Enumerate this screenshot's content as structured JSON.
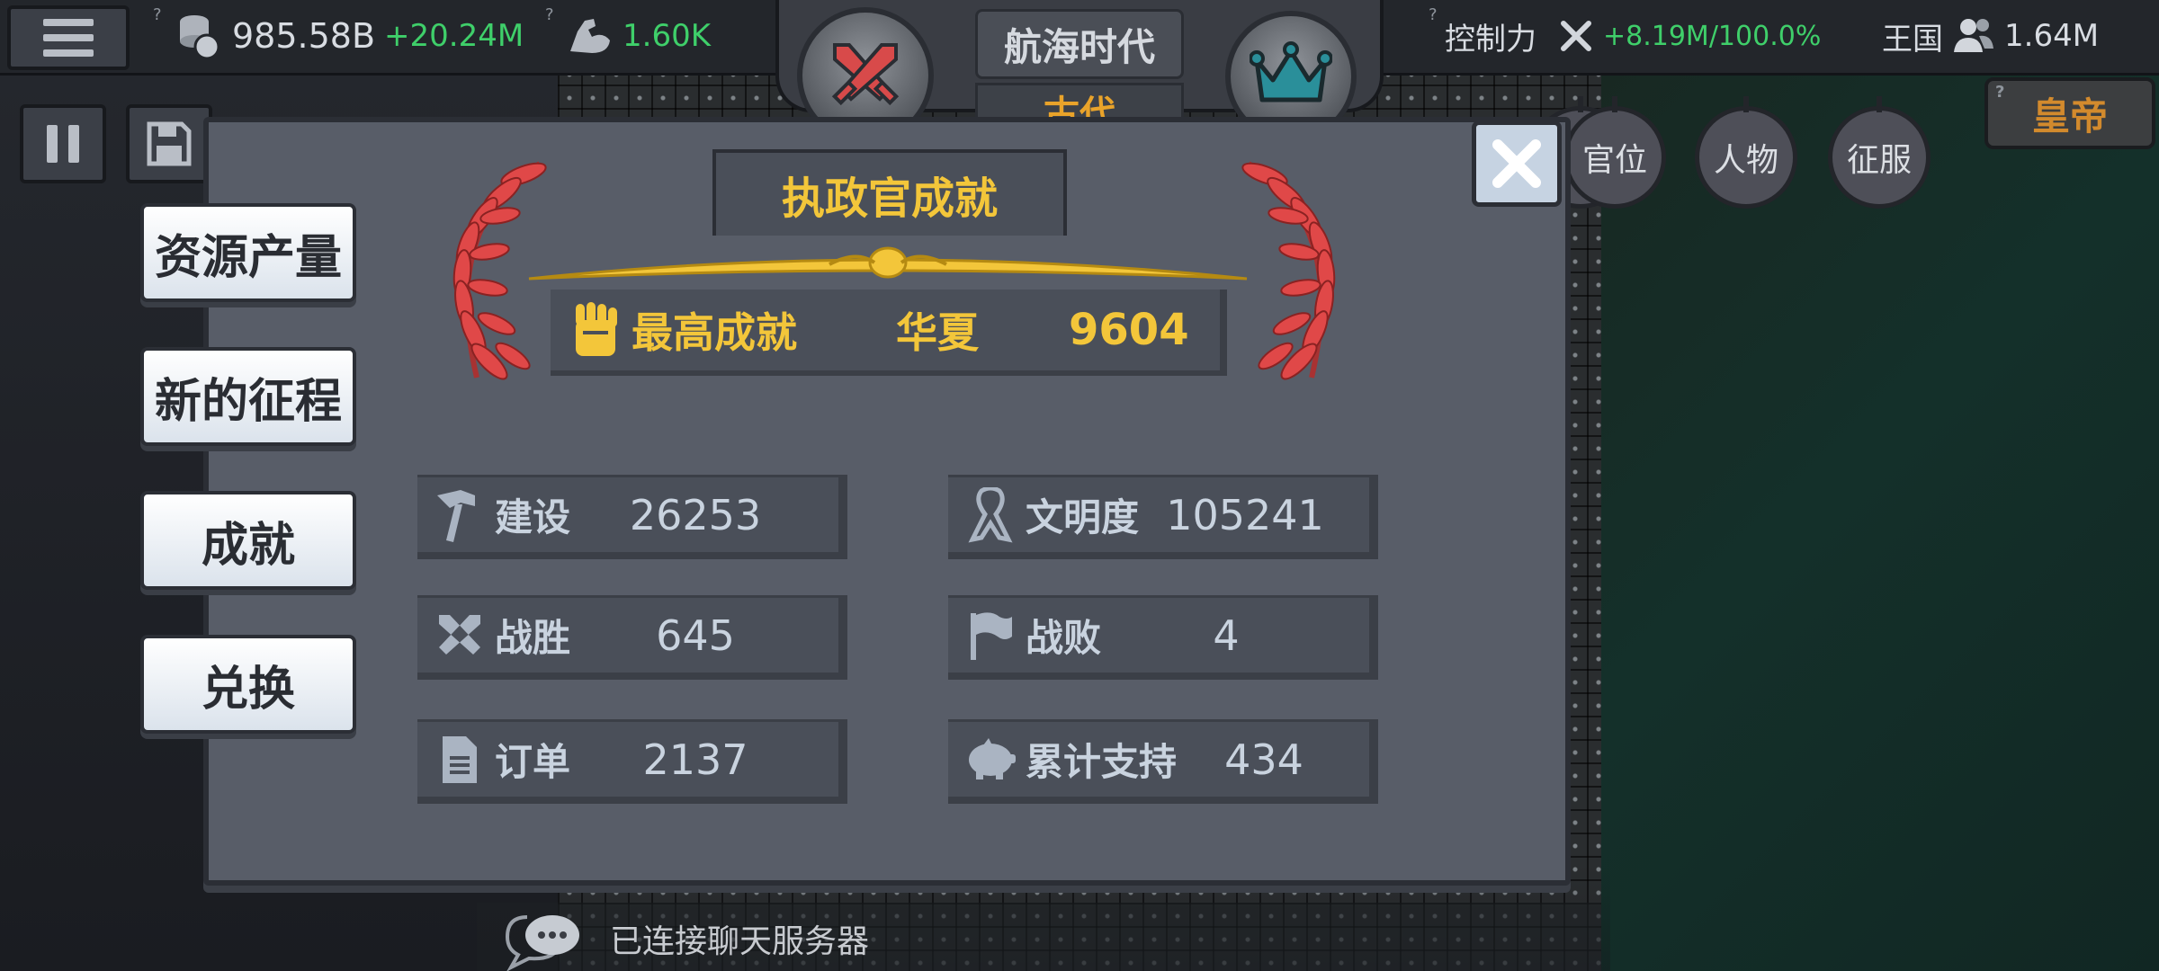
{
  "topbar": {
    "gold_value": "985.58B",
    "gold_delta": "+20.24M",
    "strength_value": "1.60K",
    "era_title": "航海时代",
    "era_sub": "古代",
    "control_label": "控制力",
    "control_delta": "+8.19M",
    "control_pct": "/100.0%",
    "kingdom_label": "王国",
    "population": "1.64M",
    "help_mark": "?"
  },
  "side_buttons": {
    "position": "官位",
    "people": "人物",
    "conquer": "征服",
    "emperor": "皇帝"
  },
  "modal": {
    "tabs": [
      {
        "label": "资源产量"
      },
      {
        "label": "新的征程"
      },
      {
        "label": "成就"
      },
      {
        "label": "兑换"
      }
    ],
    "title": "执政官成就",
    "best": {
      "label": "最高成就",
      "civ": "华夏",
      "value": "9604"
    },
    "stats": [
      {
        "label": "建设",
        "value": "26253",
        "icon": "hammer-icon"
      },
      {
        "label": "文明度",
        "value": "105241",
        "icon": "ribbon-icon"
      },
      {
        "label": "战胜",
        "value": "645",
        "icon": "crossed-swords-icon"
      },
      {
        "label": "战败",
        "value": "4",
        "icon": "flag-icon"
      },
      {
        "label": "订单",
        "value": "2137",
        "icon": "document-icon"
      },
      {
        "label": "累计支持",
        "value": "434",
        "icon": "piggy-bank-icon"
      }
    ]
  },
  "chat": {
    "status": "已连接聊天服务器"
  },
  "colors": {
    "gold": "#f3c63a",
    "positive": "#3fcf6a",
    "panel": "#585d68",
    "plate": "#4a4f59"
  }
}
